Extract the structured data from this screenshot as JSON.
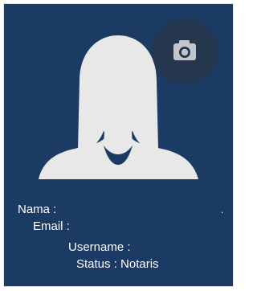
{
  "profile": {
    "nama_label": "Nama :",
    "email_label": "Email :",
    "username_label": "Username :",
    "status_label": "Status :",
    "status_value": "Notaris",
    "trailing_dot": "."
  },
  "icons": {
    "avatar": "female-user-silhouette-icon",
    "upload": "camera-icon"
  },
  "colors": {
    "card_background": "#1b3b64",
    "silhouette": "#e8e8e8",
    "camera_circle": "#25374f",
    "camera_glyph": "#c2c6cc",
    "text": "#ffffff"
  }
}
